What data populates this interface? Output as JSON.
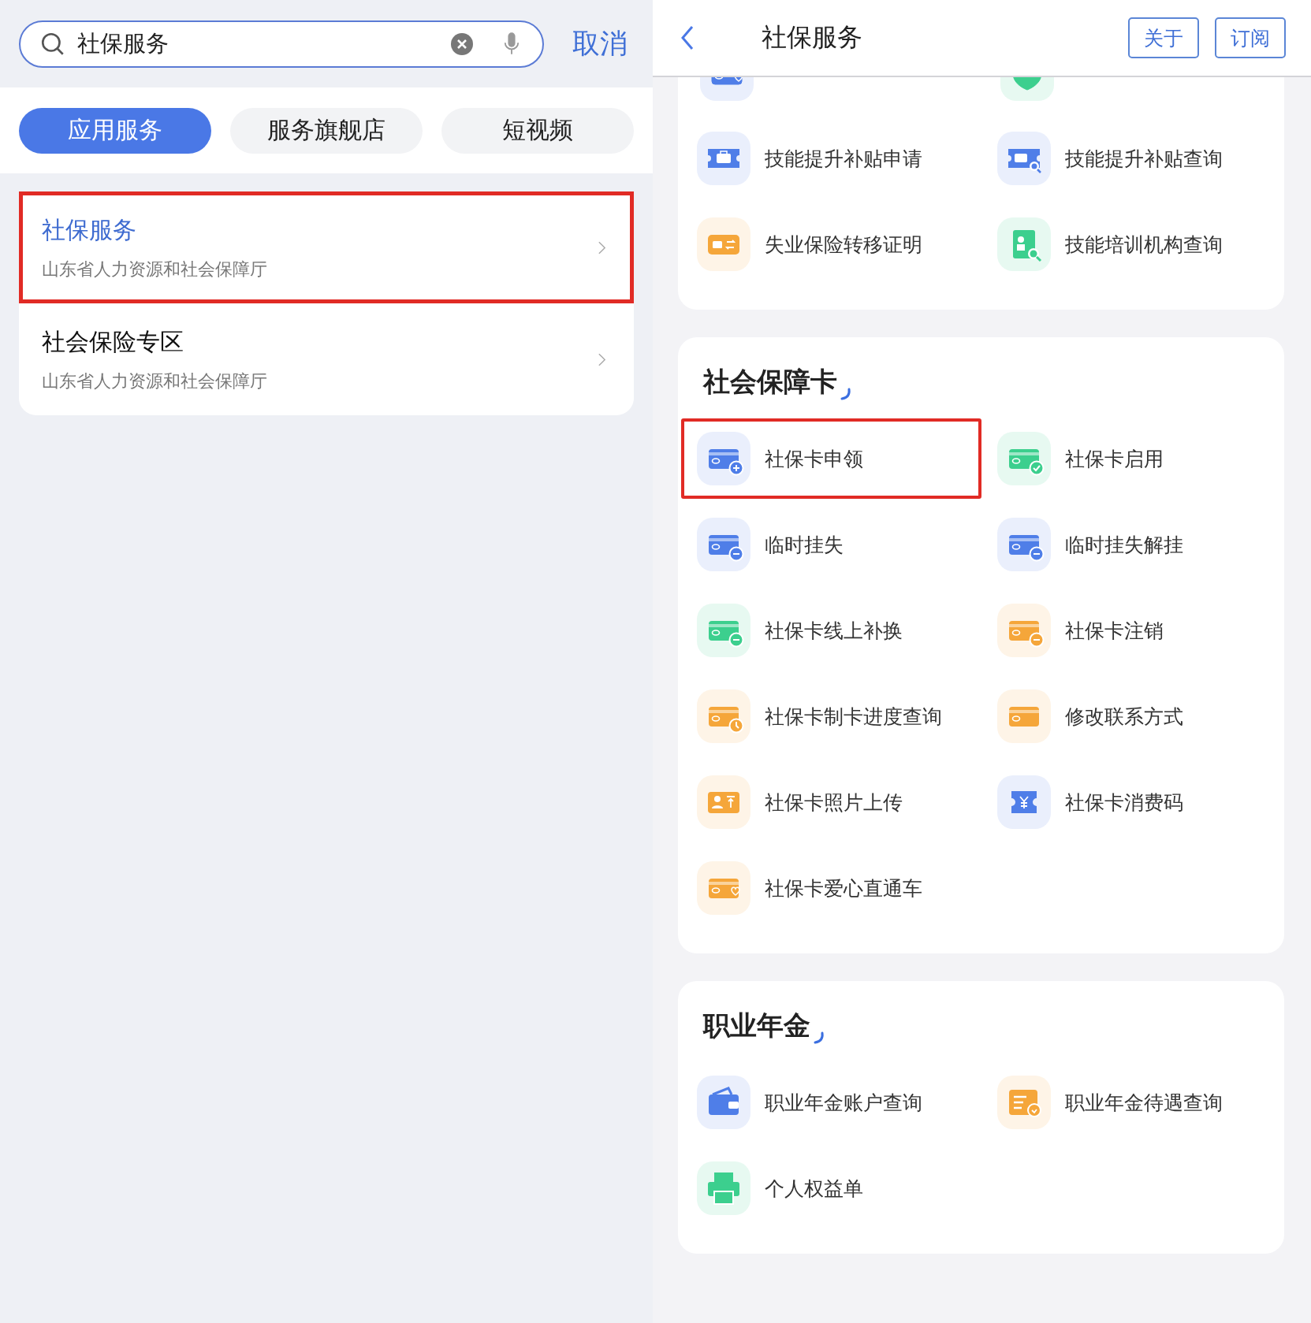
{
  "search": {
    "value": "社保服务",
    "cancel": "取消"
  },
  "tabs": [
    {
      "label": "应用服务",
      "selected": true
    },
    {
      "label": "服务旗舰店",
      "selected": false
    },
    {
      "label": "短视频",
      "selected": false
    }
  ],
  "results": [
    {
      "title": "社保服务",
      "subtitle": "山东省人力资源和社会保障厅",
      "highlighted": true
    },
    {
      "title": "社会保险专区",
      "subtitle": "山东省人力资源和社会保障厅",
      "highlighted": false
    }
  ],
  "header": {
    "title": "社保服务",
    "buttons": [
      "关于",
      "订阅"
    ]
  },
  "sections": [
    {
      "partial_items": [
        {
          "kind": "card-heart",
          "color": "#4f7ee8"
        },
        {
          "kind": "shield",
          "color": "#3ccf8e"
        }
      ],
      "items": [
        {
          "label": "技能提升补贴申请",
          "kind": "briefcase",
          "color": "#4f7ee8",
          "highlighted": false
        },
        {
          "label": "技能提升补贴查询",
          "kind": "briefcase-search",
          "color": "#4f7ee8",
          "highlighted": false
        },
        {
          "label": "失业保险转移证明",
          "kind": "briefcase-swap",
          "color": "#f5a63a",
          "highlighted": false
        },
        {
          "label": "技能培训机构查询",
          "kind": "doc-search",
          "color": "#3ccf8e",
          "highlighted": false
        }
      ]
    },
    {
      "title": "社会保障卡",
      "items": [
        {
          "label": "社保卡申领",
          "kind": "card-add",
          "color": "#4f7ee8",
          "highlighted": true
        },
        {
          "label": "社保卡启用",
          "kind": "card-check",
          "color": "#3ccf8e",
          "highlighted": false
        },
        {
          "label": "临时挂失",
          "kind": "card-minus",
          "color": "#4f7ee8",
          "highlighted": false
        },
        {
          "label": "临时挂失解挂",
          "kind": "card-minus",
          "color": "#4f7ee8",
          "highlighted": false
        },
        {
          "label": "社保卡线上补换",
          "kind": "card-minus",
          "color": "#3ccf8e",
          "highlighted": false
        },
        {
          "label": "社保卡注销",
          "kind": "card-minus",
          "color": "#f5a63a",
          "highlighted": false
        },
        {
          "label": "社保卡制卡进度查询",
          "kind": "card-clock",
          "color": "#f5a63a",
          "highlighted": false
        },
        {
          "label": "修改联系方式",
          "kind": "card",
          "color": "#f5a63a",
          "highlighted": false
        },
        {
          "label": "社保卡照片上传",
          "kind": "id-upload",
          "color": "#f5a63a",
          "highlighted": false
        },
        {
          "label": "社保卡消费码",
          "kind": "ticket",
          "color": "#4f7ee8",
          "highlighted": false
        },
        {
          "label": "社保卡爱心直通车",
          "kind": "card-heart",
          "color": "#f5a63a",
          "highlighted": false
        }
      ]
    },
    {
      "title": "职业年金",
      "items": [
        {
          "label": "职业年金账户查询",
          "kind": "wallet",
          "color": "#4f7ee8",
          "highlighted": false
        },
        {
          "label": "职业年金待遇查询",
          "kind": "doc-badge",
          "color": "#f5a63a",
          "highlighted": false
        },
        {
          "label": "个人权益单",
          "kind": "printer",
          "color": "#3ccf8e",
          "highlighted": false
        }
      ]
    }
  ]
}
